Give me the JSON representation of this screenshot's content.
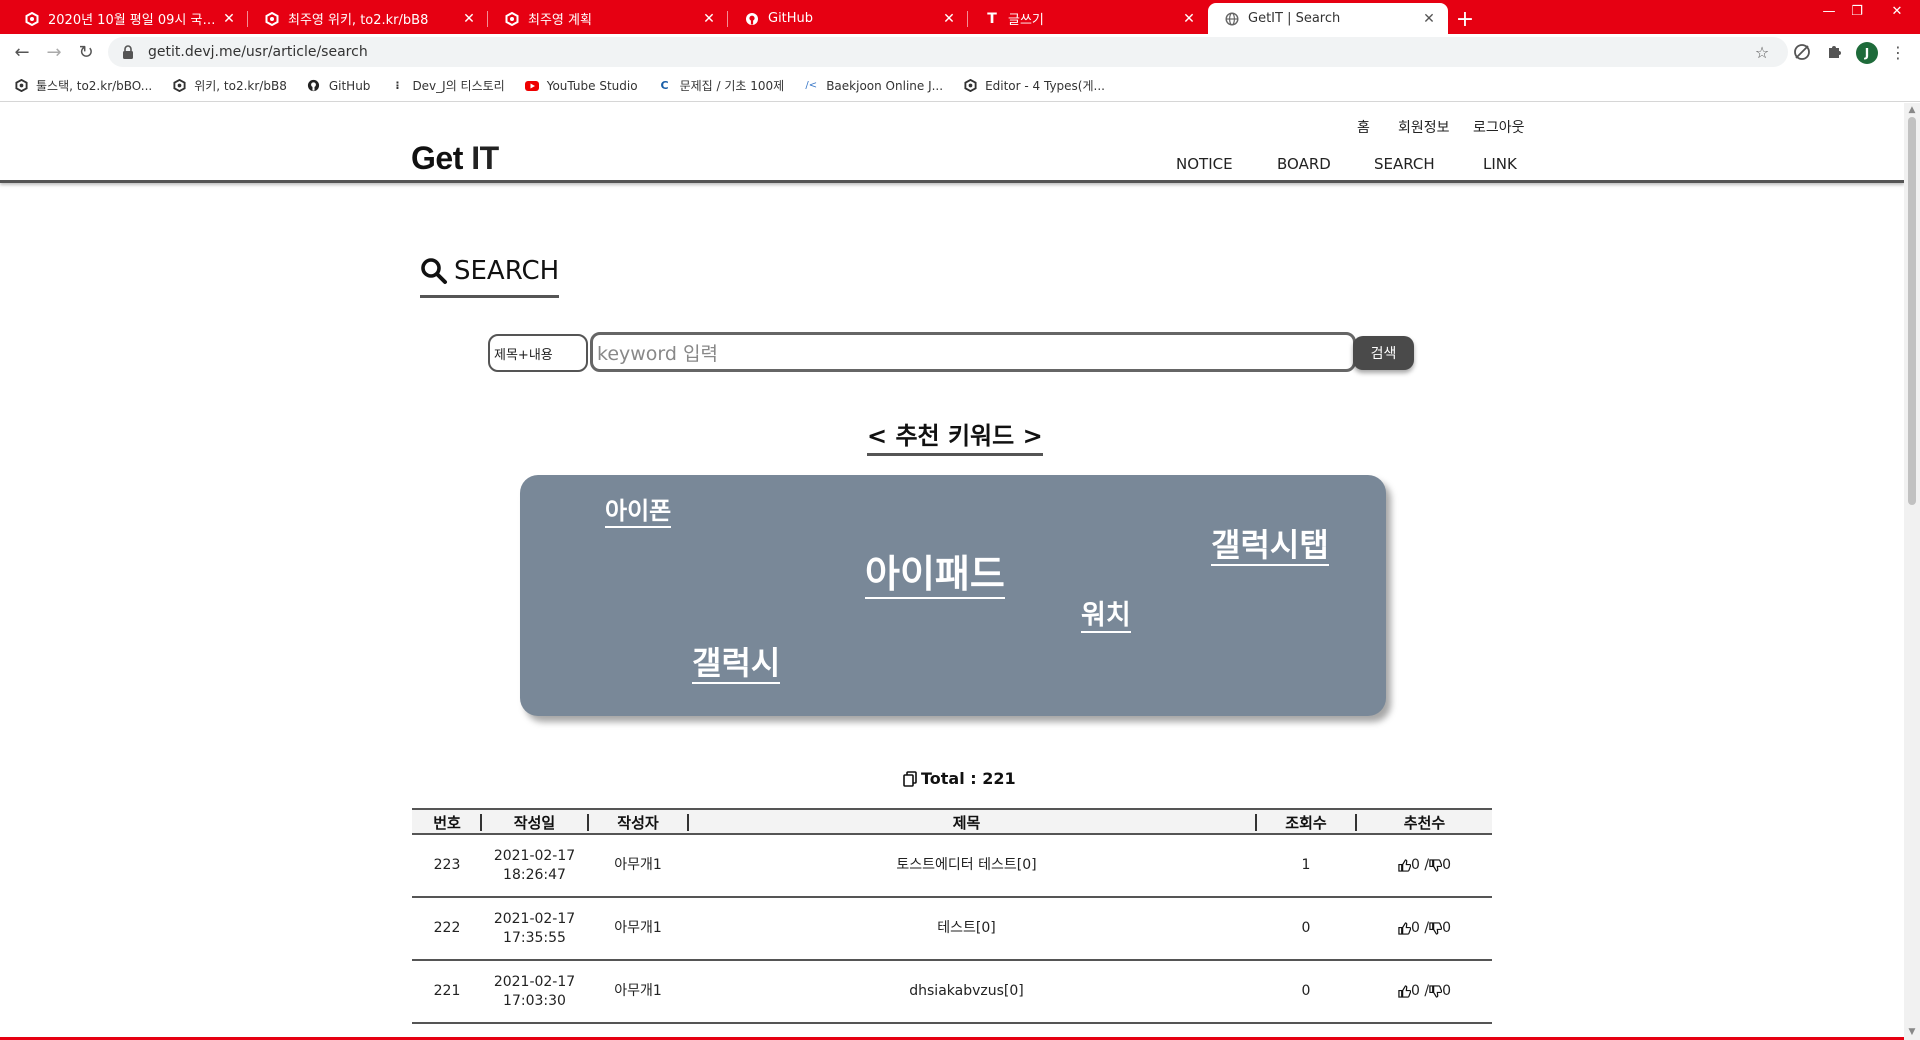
{
  "browser": {
    "tabs": [
      {
        "title": "2020년 10월 평일 09시 국기 훈...",
        "icon": "site-hex-icon",
        "active": false
      },
      {
        "title": "최주영 위키, to2.kr/bB8",
        "icon": "site-hex-icon",
        "active": false
      },
      {
        "title": "최주영 계획",
        "icon": "site-hex-icon",
        "active": false
      },
      {
        "title": "GitHub",
        "icon": "github-icon",
        "active": false
      },
      {
        "title": "글쓰기",
        "icon": "tistory-t-icon",
        "active": false
      },
      {
        "title": "GetIT | Search",
        "icon": "globe-icon",
        "active": true
      }
    ],
    "url": "getit.devj.me/usr/article/search",
    "profile_initial": "J",
    "bookmarks": [
      {
        "label": "툴스택, to2.kr/bBO...",
        "icon": "site-hex-icon"
      },
      {
        "label": "위키, to2.kr/bB8",
        "icon": "site-hex-icon"
      },
      {
        "label": "GitHub",
        "icon": "github-icon"
      },
      {
        "label": "Dev_J의 티스토리",
        "icon": "tistory-dots-icon"
      },
      {
        "label": "YouTube Studio",
        "icon": "youtube-icon"
      },
      {
        "label": "문제집 / 기초 100제",
        "icon": "codeup-icon"
      },
      {
        "label": "Baekjoon Online J...",
        "icon": "code-icon"
      },
      {
        "label": "Editor - 4 Types(게...",
        "icon": "site-hex-icon"
      }
    ]
  },
  "site": {
    "logo_left": "Get",
    "logo_right": "IT",
    "top_menu": [
      "홈",
      "회원정보",
      "로그아웃"
    ],
    "main_menu": [
      "NOTICE",
      "BOARD",
      "SEARCH",
      "LINK"
    ]
  },
  "search": {
    "title": "SEARCH",
    "type_value": "제목+내용",
    "keyword_placeholder": "keyword 입력",
    "button_label": "검색"
  },
  "recommend": {
    "title": "< 추천 키워드 >",
    "keywords": [
      "아이폰",
      "아이패드",
      "갤럭시탭",
      "워치",
      "갤럭시"
    ]
  },
  "total": {
    "label": "Total : 221"
  },
  "table": {
    "headers": [
      "번호",
      "작성일",
      "작성자",
      "제목",
      "조회수",
      "추천수"
    ],
    "rows": [
      {
        "id": "223",
        "date": "2021-02-17",
        "time": "18:26:47",
        "writer": "아무개1",
        "title": "토스트에디터 테스트[0]",
        "views": "1",
        "likes": "0",
        "dislikes": "0"
      },
      {
        "id": "222",
        "date": "2021-02-17",
        "time": "17:35:55",
        "writer": "아무개1",
        "title": "테스트[0]",
        "views": "0",
        "likes": "0",
        "dislikes": "0"
      },
      {
        "id": "221",
        "date": "2021-02-17",
        "time": "17:03:30",
        "writer": "아무개1",
        "title": "dhsiakabvzus[0]",
        "views": "0",
        "likes": "0",
        "dislikes": "0"
      }
    ]
  },
  "colors": {
    "tabstrip": "#e60012",
    "keyword_cloud": "#798898",
    "search_button": "#4a4a4a"
  }
}
